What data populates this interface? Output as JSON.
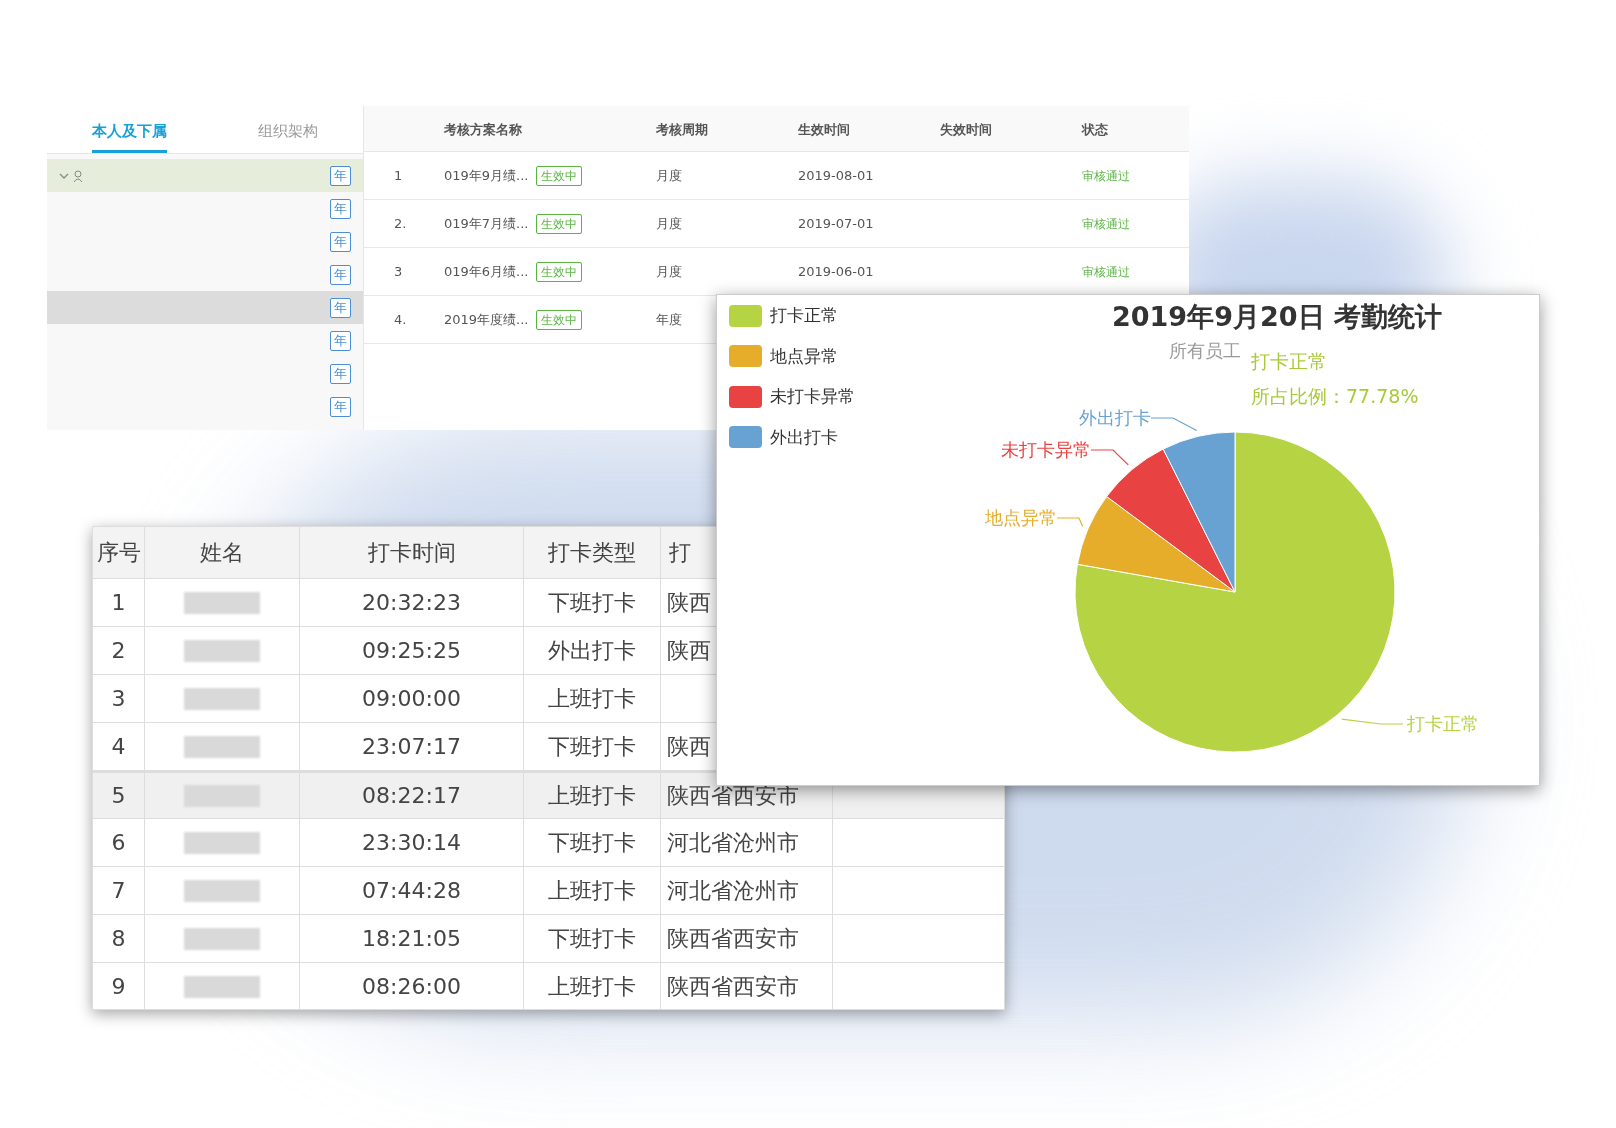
{
  "plan_panel": {
    "tabs": [
      {
        "label": "本人及下属",
        "selected": true
      },
      {
        "label": "组织架构",
        "selected": false
      }
    ],
    "tree_items": [
      {
        "badge": "年",
        "selected": true,
        "expanded": true,
        "highlighted": false
      },
      {
        "badge": "年",
        "selected": false,
        "highlighted": false
      },
      {
        "badge": "年",
        "selected": false,
        "highlighted": false
      },
      {
        "badge": "年",
        "selected": false,
        "highlighted": false
      },
      {
        "badge": "年",
        "selected": false,
        "highlighted": true
      },
      {
        "badge": "年",
        "selected": false,
        "highlighted": false
      },
      {
        "badge": "年",
        "selected": false,
        "highlighted": false
      },
      {
        "badge": "年",
        "selected": false,
        "highlighted": false
      }
    ],
    "table": {
      "columns": [
        "考核方案名称",
        "考核周期",
        "生效时间",
        "失效时间",
        "状态"
      ],
      "rows": [
        {
          "index": "1",
          "name": "019年9月绩...",
          "tag": "生效中",
          "period": "月度",
          "start": "2019-08-01",
          "status": "审核通过"
        },
        {
          "index": "2.",
          "name": "019年7月绩...",
          "tag": "生效中",
          "period": "月度",
          "start": "2019-07-01",
          "status": "审核通过"
        },
        {
          "index": "3",
          "name": "019年6月绩...",
          "tag": "生效中",
          "period": "月度",
          "start": "2019-06-01",
          "status": "审核通过"
        },
        {
          "index": "4.",
          "name": "2019年度绩...",
          "tag": "生效中",
          "period": "年度"
        }
      ]
    }
  },
  "attendance_table": {
    "columns": [
      "序号",
      "姓名",
      "打卡时间",
      "打卡类型",
      "打"
    ],
    "rows": [
      {
        "index": "1",
        "time": "20:32:23",
        "type": "下班打卡",
        "place": "陕西",
        "selected": false
      },
      {
        "index": "2",
        "time": "09:25:25",
        "type": "外出打卡",
        "place": "陕西",
        "selected": false
      },
      {
        "index": "3",
        "time": "09:00:00",
        "type": "上班打卡",
        "selected": false
      },
      {
        "index": "4",
        "time": "23:07:17",
        "type": "下班打卡",
        "place": "陕西",
        "selected": false
      },
      {
        "index": "5",
        "time": "08:22:17",
        "type": "上班打卡",
        "place": "陕西省西安市",
        "selected": true
      },
      {
        "index": "6",
        "time": "23:30:14",
        "type": "下班打卡",
        "place": "河北省沧州市",
        "selected": false
      },
      {
        "index": "7",
        "time": "07:44:28",
        "type": "上班打卡",
        "place": "河北省沧州市",
        "selected": false
      },
      {
        "index": "8",
        "time": "18:21:05",
        "type": "下班打卡",
        "place": "陕西省西安市",
        "selected": false
      },
      {
        "index": "9",
        "time": "08:26:00",
        "type": "上班打卡",
        "place": "陕西省西安市",
        "selected": false
      }
    ]
  },
  "stats_chart": {
    "legend": [
      "打卡正常",
      "地点异常",
      "未打卡异常",
      "外出打卡"
    ],
    "tooltip": {
      "title": "打卡正常",
      "text": "所占比例：77.78%"
    },
    "chart_data": {
      "type": "pie",
      "title": "2019年9月20日 考勤统计",
      "categories": [
        "打卡正常",
        "地点异常",
        "未打卡异常",
        "外出打卡"
      ],
      "series": [
        {
          "name": "所有员工",
          "values": [
            77.78,
            7.41,
            7.41,
            7.41
          ]
        }
      ],
      "colors": [
        "#b5d342",
        "#e5ad2a",
        "#e84342",
        "#67a2d3"
      ]
    }
  }
}
